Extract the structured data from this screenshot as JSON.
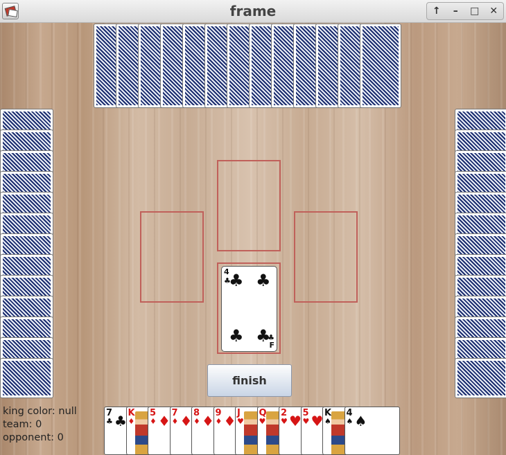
{
  "window": {
    "title": "frame",
    "controls": {
      "up": "↑",
      "minimize": "–",
      "maximize": "□",
      "close": "✕"
    }
  },
  "table": {
    "north_hand_count": 13,
    "west_hand_count": 13,
    "east_hand_count": 13,
    "trick_center": {
      "played_card": {
        "rank": "4",
        "suit": "♣",
        "color": "black",
        "corner_letter": "F"
      }
    }
  },
  "finish_button": {
    "label": "finish"
  },
  "status": {
    "king_color": "king color: null",
    "team": "team: 0",
    "opponent": "opponent: 0"
  },
  "player_hand": [
    {
      "rank": "7",
      "suit": "♣",
      "color": "black",
      "face": false
    },
    {
      "rank": "K",
      "suit": "♦",
      "color": "red",
      "face": true
    },
    {
      "rank": "5",
      "suit": "♦",
      "color": "red",
      "face": false
    },
    {
      "rank": "7",
      "suit": "♦",
      "color": "red",
      "face": false
    },
    {
      "rank": "8",
      "suit": "♦",
      "color": "red",
      "face": false
    },
    {
      "rank": "9",
      "suit": "♦",
      "color": "red",
      "face": false
    },
    {
      "rank": "J",
      "suit": "♥",
      "color": "red",
      "face": true
    },
    {
      "rank": "Q",
      "suit": "♥",
      "color": "red",
      "face": true
    },
    {
      "rank": "2",
      "suit": "♥",
      "color": "red",
      "face": false
    },
    {
      "rank": "5",
      "suit": "♥",
      "color": "red",
      "face": false
    },
    {
      "rank": "K",
      "suit": "♠",
      "color": "black",
      "face": true
    },
    {
      "rank": "4",
      "suit": "♠",
      "color": "black",
      "face": false
    }
  ],
  "colors": {
    "card_back": "#1a2c6e",
    "slot_border": "#c0605a",
    "red_suit": "#d61515",
    "black_suit": "#111111"
  }
}
